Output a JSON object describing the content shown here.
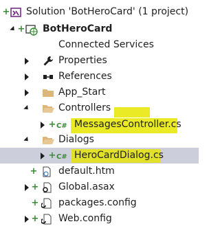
{
  "solution_explorer": {
    "solution_label": "Solution 'BotHeroCard' (1 project)",
    "project_label": "BotHeroCard",
    "items": [
      {
        "label": "Connected Services"
      },
      {
        "label": "Properties"
      },
      {
        "label": "References"
      },
      {
        "label": "App_Start"
      },
      {
        "label": "Controllers"
      },
      {
        "label": "MessagesController.cs"
      },
      {
        "label": "Dialogs"
      },
      {
        "label": "HeroCardDialog.cs"
      },
      {
        "label": "default.htm"
      },
      {
        "label": "Global.asax"
      },
      {
        "label": "packages.config"
      },
      {
        "label": "Web.config"
      }
    ],
    "highlight_color": "#e6e600",
    "selection_color": "#cccedb",
    "folder_color": "#dcb67a",
    "vs_purple": "#68217a",
    "add_green": "#388a34",
    "csharp_green": "#388a34"
  }
}
